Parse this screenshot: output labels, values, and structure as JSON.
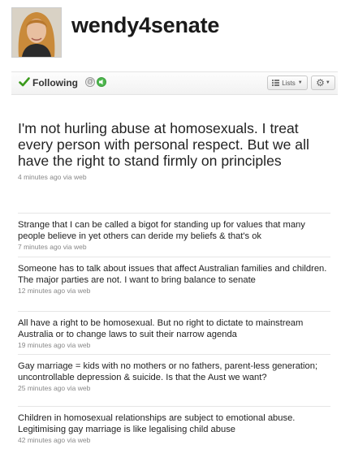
{
  "profile": {
    "username": "wendy4senate"
  },
  "actions": {
    "following_label": "Following",
    "lists_label": "Lists"
  },
  "main_tweet": {
    "text": "I'm not hurling abuse at homosexuals. I treat every person with personal respect. But we all have the right to stand firmly on principles",
    "meta": "4 minutes ago via web"
  },
  "tweets": [
    {
      "text": "Strange that I can be called a bigot for standing up for values that many people believe in yet others can deride my beliefs & that's ok",
      "meta": "7 minutes ago via web"
    },
    {
      "text": "Someone has to talk about issues that affect Australian families and children. The major parties are not. I want to bring balance to senate",
      "meta": "12 minutes ago via web"
    },
    {
      "text": "All have a right to be homosexual. But no right to dictate to mainstream Australia or to change laws to suit their narrow agenda",
      "meta": "19 minutes ago via web"
    },
    {
      "text": "Gay marriage = kids with no mothers or no fathers, parent-less generation; uncontrollable depression & suicide. Is that the Aust we want?",
      "meta": "25 minutes ago via web"
    },
    {
      "text": "Children in homosexual relationships are subject to emotional abuse. Legitimising gay marriage is like legalising child abuse",
      "meta": "42 minutes ago via web"
    }
  ],
  "icons": {
    "follow": "checkmark-icon",
    "mention": "mention-icon",
    "device": "device-notification-icon",
    "lists": "lists-icon",
    "settings": "gear-icon"
  },
  "colors": {
    "following_check": "#3b9a1c",
    "device_icon": "#4db74d",
    "meta_text": "#888888"
  }
}
